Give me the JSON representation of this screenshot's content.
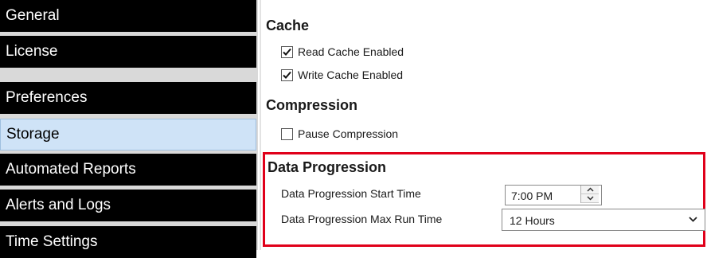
{
  "sidebar": {
    "items": [
      {
        "label": "General"
      },
      {
        "label": "License"
      },
      {
        "label": "Preferences"
      },
      {
        "label": "Storage"
      },
      {
        "label": "Automated Reports"
      },
      {
        "label": "Alerts and Logs"
      },
      {
        "label": "Time Settings"
      }
    ],
    "selected": "Storage"
  },
  "cache": {
    "title": "Cache",
    "read_label": "Read Cache Enabled",
    "read_checked": true,
    "write_label": "Write Cache Enabled",
    "write_checked": true
  },
  "compression": {
    "title": "Compression",
    "pause_label": "Pause Compression",
    "pause_checked": false
  },
  "data_progression": {
    "title": "Data Progression",
    "start_time_label": "Data Progression Start Time",
    "start_time_value": "7:00 PM",
    "max_run_label": "Data Progression Max Run Time",
    "max_run_value": "12 Hours"
  },
  "colors": {
    "nav_bg": "#000000",
    "nav_active_bg": "#cfe3f7",
    "highlight_border": "#e0001a"
  }
}
